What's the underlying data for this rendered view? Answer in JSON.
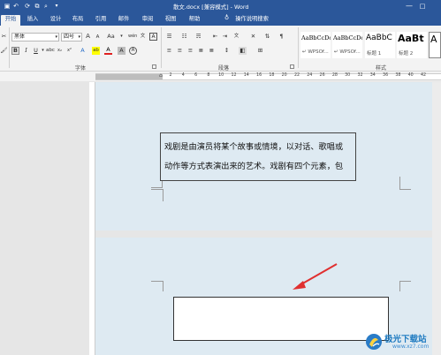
{
  "titlebar": {
    "title": "散文.docx [兼容模式] - Word"
  },
  "tabs": [
    {
      "label": "开始",
      "active": true
    },
    {
      "label": "插入"
    },
    {
      "label": "设计"
    },
    {
      "label": "布局"
    },
    {
      "label": "引用"
    },
    {
      "label": "邮件"
    },
    {
      "label": "审阅"
    },
    {
      "label": "视图"
    },
    {
      "label": "帮助"
    },
    {
      "label": "操作说明搜索"
    }
  ],
  "ribbon": {
    "font_name": "黑体",
    "font_size": "四号",
    "bold": "B",
    "italic": "I",
    "underline": "U",
    "grow_font": "A",
    "shrink_font": "A",
    "change_case": "Aa",
    "phonetic": "wén",
    "char_border": "A",
    "text_effect": "A",
    "highlight": "ab",
    "font_color": "A",
    "shading": "A",
    "char_enclose": "A",
    "group_font": "字体",
    "group_paragraph": "段落",
    "group_styles": "样式",
    "styles": [
      {
        "preview": "AaBbCcDc",
        "name": "WPSOf..."
      },
      {
        "preview": "AaBbCcDc",
        "name": "WPSOf..."
      },
      {
        "preview": "AaBbC",
        "name": "标题 1"
      },
      {
        "preview": "AaBt",
        "name": "标题 2"
      },
      {
        "preview": "A",
        "name": ""
      }
    ]
  },
  "ruler": {
    "numbers": [
      "2",
      "4",
      "6",
      "8",
      "10",
      "12",
      "14",
      "16",
      "18",
      "20",
      "22",
      "24",
      "26",
      "28",
      "30",
      "32",
      "34",
      "36",
      "38",
      "40",
      "42"
    ]
  },
  "document": {
    "textbox_lines": [
      "戏剧是由演员将某个故事或情境，以对话、歌唱或",
      "动作等方式表演出来的艺术。戏剧有四个元素，包"
    ]
  },
  "watermark": {
    "title": "极光下载站",
    "url": "www.xz7.com"
  },
  "colors": {
    "accent": "#2b579a",
    "page_tint": "#deeaf2",
    "arrow": "#e03030"
  }
}
